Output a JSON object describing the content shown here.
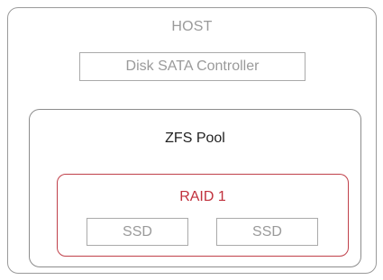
{
  "host": {
    "title": "HOST",
    "controller_label": "Disk SATA Controller"
  },
  "pool": {
    "title": "ZFS Pool",
    "raid": {
      "title": "RAID 1",
      "disks": [
        "SSD",
        "SSD"
      ]
    }
  },
  "colors": {
    "border_gray": "#9a9a9a",
    "raid_red": "#c0404a",
    "text_gray": "#9a9a9a",
    "text_dark": "#222222"
  }
}
